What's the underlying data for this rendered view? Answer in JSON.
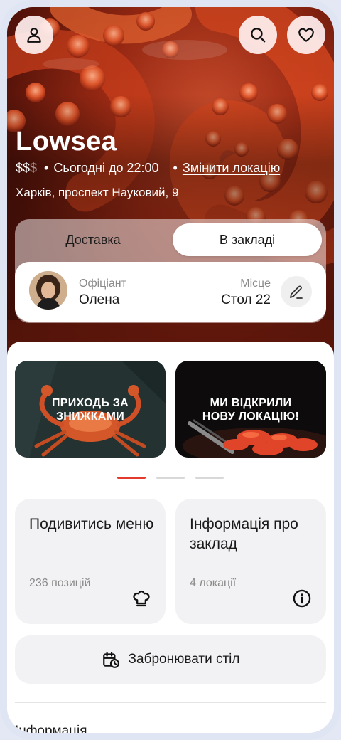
{
  "header": {
    "profile_icon": "user-icon",
    "search_icon": "search-icon",
    "favorite_icon": "heart-icon"
  },
  "restaurant": {
    "name": "Lowsea",
    "price_level_active": "$$",
    "price_level_inactive": "$",
    "hours": "Сьогодні до 22:00",
    "change_location": "Змінити локацію",
    "address": "Харків, проспект Науковий, 9"
  },
  "mode_tabs": [
    {
      "label": "Доставка",
      "selected": false
    },
    {
      "label": "В закладі",
      "selected": true
    }
  ],
  "waiter": {
    "role_label": "Офіціант",
    "name": "Олена",
    "place_label": "Місце",
    "place_value": "Стол 22",
    "edit_icon": "pencil-icon"
  },
  "promos": [
    {
      "text_line1": "ПРИХОДЬ ЗА",
      "text_line2": "ЗНИЖКАМИ"
    },
    {
      "text_line1": "МИ ВІДКРИЛИ",
      "text_line2": "НОВУ ЛОКАЦІЮ!"
    }
  ],
  "carousel": {
    "total": 3,
    "active_index": 0
  },
  "tiles": [
    {
      "title": "Подивитись меню",
      "subtitle": "236 позицій",
      "icon": "chef-hat-icon"
    },
    {
      "title": "Інформація про заклад",
      "subtitle": "4 локації",
      "icon": "info-icon"
    }
  ],
  "book_table": {
    "label": "Забронювати стіл",
    "icon": "calendar-clock-icon"
  },
  "info_section": {
    "heading": "Інформація"
  },
  "colors": {
    "accent": "#e23b2e",
    "tile_bg": "#f2f2f4",
    "frame": "#dfe5f3"
  }
}
